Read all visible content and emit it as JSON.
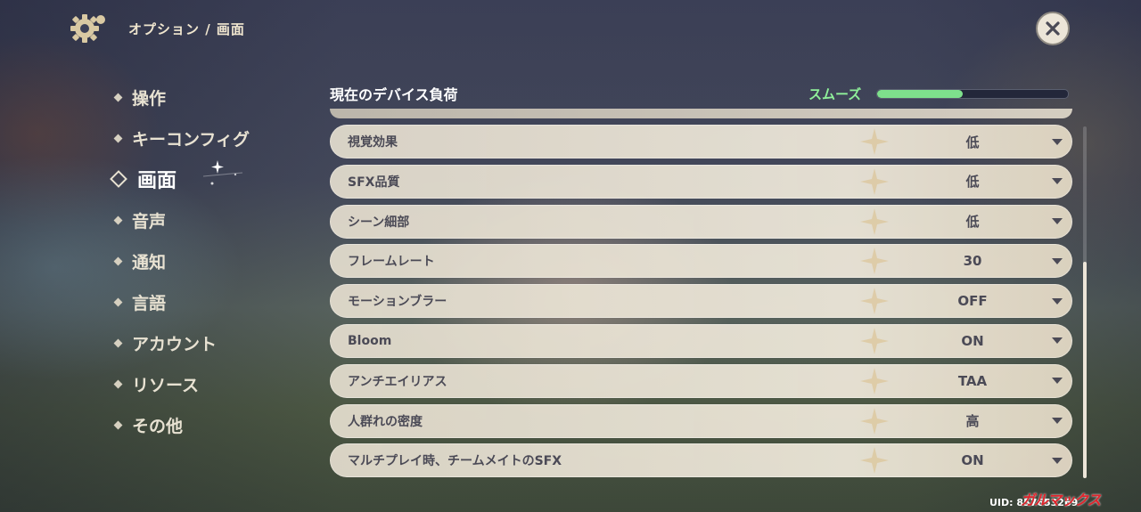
{
  "header": {
    "breadcrumb": "オプション / 画面"
  },
  "sidebar": {
    "items": [
      {
        "label": "操作"
      },
      {
        "label": "キーコンフィグ"
      },
      {
        "label": "画面",
        "active": true
      },
      {
        "label": "音声"
      },
      {
        "label": "通知"
      },
      {
        "label": "言語"
      },
      {
        "label": "アカウント"
      },
      {
        "label": "リソース"
      },
      {
        "label": "その他"
      }
    ]
  },
  "device_load": {
    "title": "現在のデバイス負荷",
    "status": "スムーズ",
    "level_percent": 45
  },
  "settings": [
    {
      "label": "視覚効果",
      "value": "低"
    },
    {
      "label": "SFX品質",
      "value": "低"
    },
    {
      "label": "シーン細部",
      "value": "低"
    },
    {
      "label": "フレームレート",
      "value": "30"
    },
    {
      "label": "モーションブラー",
      "value": "OFF"
    },
    {
      "label": "Bloom",
      "value": "ON"
    },
    {
      "label": "アンチエイリアス",
      "value": "TAA"
    },
    {
      "label": "人群れの密度",
      "value": "高"
    },
    {
      "label": "マルチプレイ時、チームメイトのSFX",
      "value": "ON"
    }
  ],
  "footer": {
    "uid": "UID: 857653269",
    "watermark": "ガルマックス"
  },
  "colors": {
    "accent_green": "#7ee08c",
    "row_bg": "#ece6d8",
    "text_dark": "#4b4a56"
  }
}
